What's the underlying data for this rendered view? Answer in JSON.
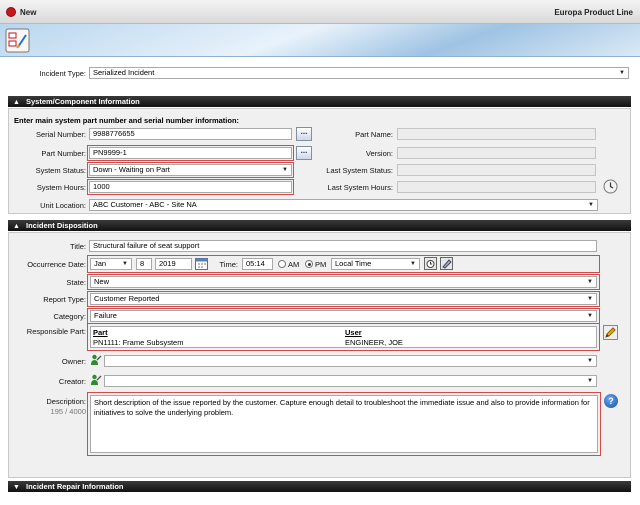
{
  "window": {
    "title": "New",
    "product_line": "Europa Product Line"
  },
  "incident_type": {
    "label": "Incident Type:",
    "value": "Serialized Incident"
  },
  "system_section": {
    "header": "System/Component Information",
    "instruction": "Enter main system part number and serial number information:",
    "serial_number": {
      "label": "Serial Number:",
      "value": "9988776655"
    },
    "part_number": {
      "label": "Part Number:",
      "value": "PN9999-1"
    },
    "system_status": {
      "label": "System Status:",
      "value": "Down - Waiting on Part"
    },
    "system_hours": {
      "label": "System Hours:",
      "value": "1000"
    },
    "unit_location": {
      "label": "Unit Location:",
      "value": "ABC Customer - ABC - Site NA"
    },
    "part_name": {
      "label": "Part Name:",
      "value": ""
    },
    "version": {
      "label": "Version:",
      "value": ""
    },
    "last_system_status": {
      "label": "Last System Status:",
      "value": ""
    },
    "last_system_hours": {
      "label": "Last System Hours:",
      "value": ""
    },
    "lookup_label": "..."
  },
  "incident_section": {
    "header": "Incident Disposition",
    "title": {
      "label": "Title:",
      "value": "Structural failure of seat support"
    },
    "occurrence_date": {
      "label": "Occurrence Date:",
      "month": "Jan",
      "day": "8",
      "year": "2019"
    },
    "time": {
      "label": "Time:",
      "value": "05:14",
      "am": "AM",
      "pm": "PM",
      "selected": "PM",
      "timezone": "Local Time"
    },
    "state": {
      "label": "State:",
      "value": "New"
    },
    "report_type": {
      "label": "Report Type:",
      "value": "Customer Reported"
    },
    "category": {
      "label": "Category:",
      "value": "Failure"
    },
    "responsible_part": {
      "label": "Responsible Part:",
      "col_part": "Part",
      "col_user": "User",
      "row_part": "PN1111: Frame Subsystem",
      "row_user": "ENGINEER, JOE"
    },
    "owner": {
      "label": "Owner:",
      "value": ""
    },
    "creator": {
      "label": "Creator:",
      "value": ""
    },
    "description": {
      "label": "Description:",
      "count": "195 / 4000",
      "value": "Short description of the issue reported by the customer. Capture enough detail to troubleshoot the immediate issue and also to provide information for initiatives to solve the underlying problem."
    },
    "help_label": "?"
  },
  "repair_section": {
    "header": "Incident Repair Information"
  },
  "colors": {
    "required_border": "#d24a4a",
    "section_header": "#1a1a1a",
    "brand_red": "#c8161d"
  }
}
